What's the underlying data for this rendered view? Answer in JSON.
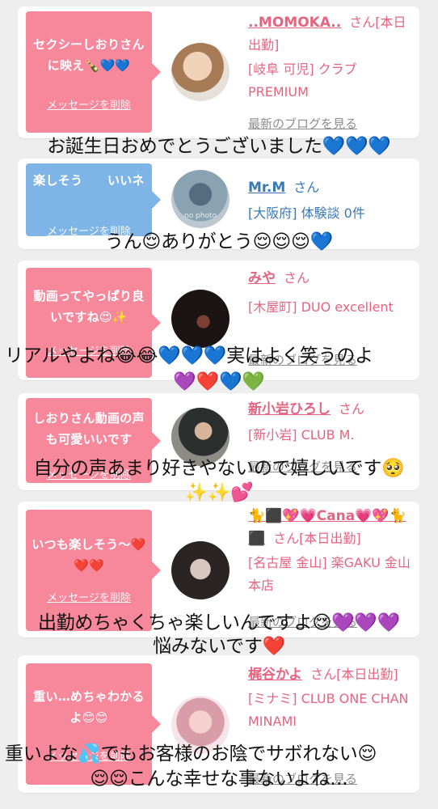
{
  "cards": [
    {
      "message": "セクシーしおりさんに映え🍾💙💙",
      "delete_label": "メッセージを削除",
      "name": "..MOMOKA..",
      "honorific_line": "さん[本日出勤]",
      "location": "[岐阜 可児] クラブ PREMIUM",
      "blog_link": "最新のブログを見る",
      "bubble_color": "#f7889b",
      "text_color": "#e66480"
    },
    {
      "message": "楽しそう　　いいネ",
      "delete_label": "メッセージを削除",
      "name": "Mr.M",
      "honorific_line": "さん",
      "location": "[大阪府] 体験談 0件",
      "avatar_caption": "no photo",
      "bubble_color": "#7fb5e6",
      "text_color": "#3779b8"
    },
    {
      "message": "動画ってやっぱり良いですね😍✨",
      "delete_label": "メッセージを削除",
      "name": "みや",
      "honorific_line": "さん",
      "location": "[木屋町] DUO excellent",
      "blog_link": "最新のブログを見る",
      "bubble_color": "#f7889b",
      "text_color": "#e66480"
    },
    {
      "message": "しおりさん動画の声も可愛いいです",
      "delete_label": "メッセージを削除",
      "name": "新小岩ひろし",
      "honorific_line": "さん",
      "location": "[新小岩] CLUB M.",
      "blog_link": "最新のブログを見る",
      "bubble_color": "#f7889b",
      "text_color": "#e66480"
    },
    {
      "message": "いつも楽しそう〜❤️❤️❤️",
      "delete_label": "メッセージを削除",
      "name": "🐈⬛💖💗Cana💗💖🐈⬛",
      "honorific_line": "さん[本日出勤]",
      "location": "[名古屋 金山] 楽GAKU 金山本店",
      "blog_link": "最新のブログを見る",
      "bubble_color": "#f7889b",
      "text_color": "#e66480"
    },
    {
      "message": "重い…めちゃわかるよ😊😊",
      "delete_label": "メッセージを削除",
      "name": "梶谷かよ",
      "honorific_line": "さん[本日出勤]",
      "location": "[ミナミ] CLUB ONE CHAN MINAMI",
      "blog_link": "最新のブログを見る",
      "bubble_color": "#f7889b",
      "text_color": "#e66480"
    }
  ],
  "replies": [
    "お誕生日おめでとうございました💙💙💙",
    "うん😌ありがとう😌😌😌💙",
    "リアルやよね😂😂💙💙💙実はよく笑うのよ",
    "💜❤️💙💚",
    "自分の声あまり好きやないので嬉しいです🥺",
    "✨✨💕",
    "出勤めちゃくちゃ楽しいんですよ😌💜💜💜",
    "悩みないです❤️",
    "重いよな💦でもお客様のお陰でサボれない😌",
    "😌😌こんな幸せな事ないよね…"
  ]
}
